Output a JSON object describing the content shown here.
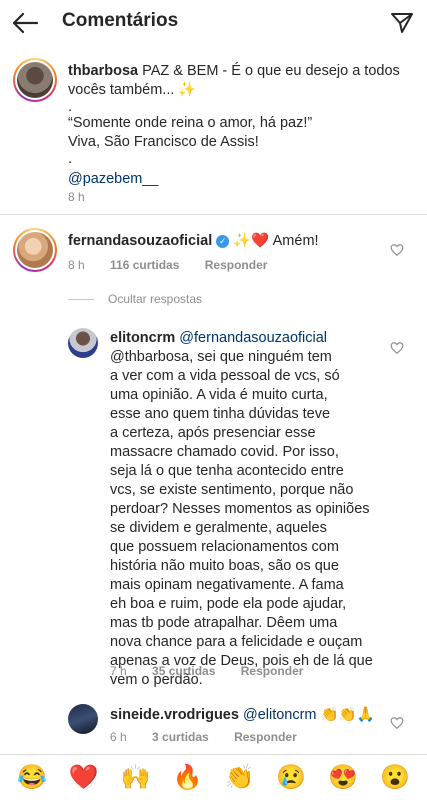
{
  "header": {
    "title": "Comentários"
  },
  "post": {
    "username": "thbarbosa",
    "lines": [
      "PAZ & BEM - É o que eu desejo a todos",
      "vocês também... ✨",
      ".",
      "“Somente onde reina o amor, há paz!”",
      "Viva, São Francisco de Assis!",
      ".",
      "@pazebem__"
    ],
    "time": "8 h"
  },
  "comment1": {
    "username": "fernandasouzaoficial",
    "text": "✨❤️ Amém!",
    "time": "8 h",
    "likes": "116 curtidas",
    "reply": "Responder"
  },
  "hide_replies": "Ocultar respostas",
  "reply1": {
    "username": "elitoncrm",
    "lines": [
      "@fernandasouzaoficial",
      "@thbarbosa, sei que ninguém tem",
      "a ver com a vida pessoal de vcs, só",
      "uma opinião. A vida é muito curta,",
      "esse ano quem tinha dúvidas teve",
      "a certeza, após presenciar esse",
      "massacre chamado covid. Por isso,",
      "seja lá o que tenha acontecido entre",
      "vcs, se existe sentimento, porque não",
      "perdoar? Nesses momentos as opiniões",
      "se dividem e geralmente, aqueles",
      "que possuem relacionamentos com",
      "história não muito boas, são os que",
      "mais opinam negativamente. A fama",
      "eh boa e ruim, pode ela pode ajudar,",
      "mas tb pode atrapalhar. Dêem uma",
      "nova chance para a felicidade e ouçam",
      "apenas a voz de Deus, pois eh de lá que",
      "vem o perdão."
    ],
    "time": "7 h",
    "likes": "35 curtidas",
    "reply": "Responder"
  },
  "reply2": {
    "username": "sineide.vrodrigues",
    "mention": "@elitoncrm",
    "text": "👏👏🙏",
    "time": "6 h",
    "likes": "3 curtidas",
    "reply": "Responder"
  },
  "emoji_bar": [
    "😂",
    "❤️",
    "🙌",
    "🔥",
    "👏",
    "😢",
    "😍",
    "😮"
  ]
}
